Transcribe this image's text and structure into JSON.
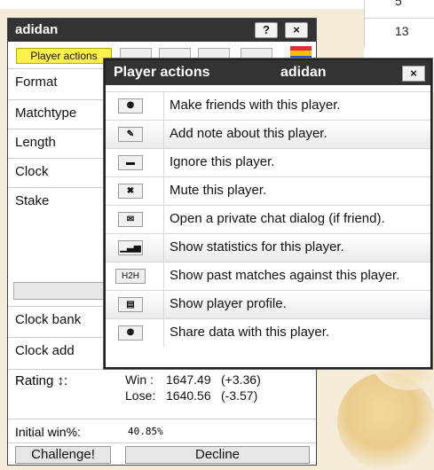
{
  "background": {
    "table_cells": [
      "5",
      "13"
    ]
  },
  "dialog": {
    "title": "adidan",
    "help_icon": "?",
    "close_icon": "×",
    "player_actions_label": "Player actions",
    "flag_colors": [
      "#e03030",
      "#f0c000",
      "#2a5bd7"
    ],
    "fields": [
      "Format",
      "Matchtype",
      "Length",
      "Clock",
      "Stake"
    ],
    "clock_fields": [
      "Clock bank",
      "Clock add"
    ],
    "rating_label": "Rating ↕:",
    "win_label": "Win :",
    "win_value": "1647.49",
    "win_delta": "(+3.36)",
    "lose_label": "Lose:",
    "lose_value": "1640.56",
    "lose_delta": "(-3.57)",
    "initial_win_label": "Initial win%:",
    "initial_win_value": "40.85%",
    "challenge_label": "Challenge!",
    "decline_label": "Decline"
  },
  "popup": {
    "title": "Player actions",
    "user": "adidan",
    "close_icon": "×",
    "actions": [
      {
        "icon": "handshake-icon",
        "glyph": "⚉",
        "label": "Make friends with this player."
      },
      {
        "icon": "note-icon",
        "glyph": "✎",
        "label": "Add note about this player."
      },
      {
        "icon": "ignore-icon",
        "glyph": "▬",
        "label": "Ignore this player."
      },
      {
        "icon": "mute-icon",
        "glyph": "✖",
        "label": "Mute this player."
      },
      {
        "icon": "chat-icon",
        "glyph": "✉",
        "label": "Open a private chat dialog (if friend)."
      },
      {
        "icon": "stats-icon",
        "glyph": "▁▃▅",
        "label": "Show statistics for this player."
      },
      {
        "icon": "h2h-icon",
        "glyph": "H2H",
        "label": "Show past matches against this player."
      },
      {
        "icon": "profile-icon",
        "glyph": "▤",
        "label": "Show player profile."
      },
      {
        "icon": "share-icon",
        "glyph": "⚉",
        "label": "Share data with this player."
      }
    ]
  }
}
